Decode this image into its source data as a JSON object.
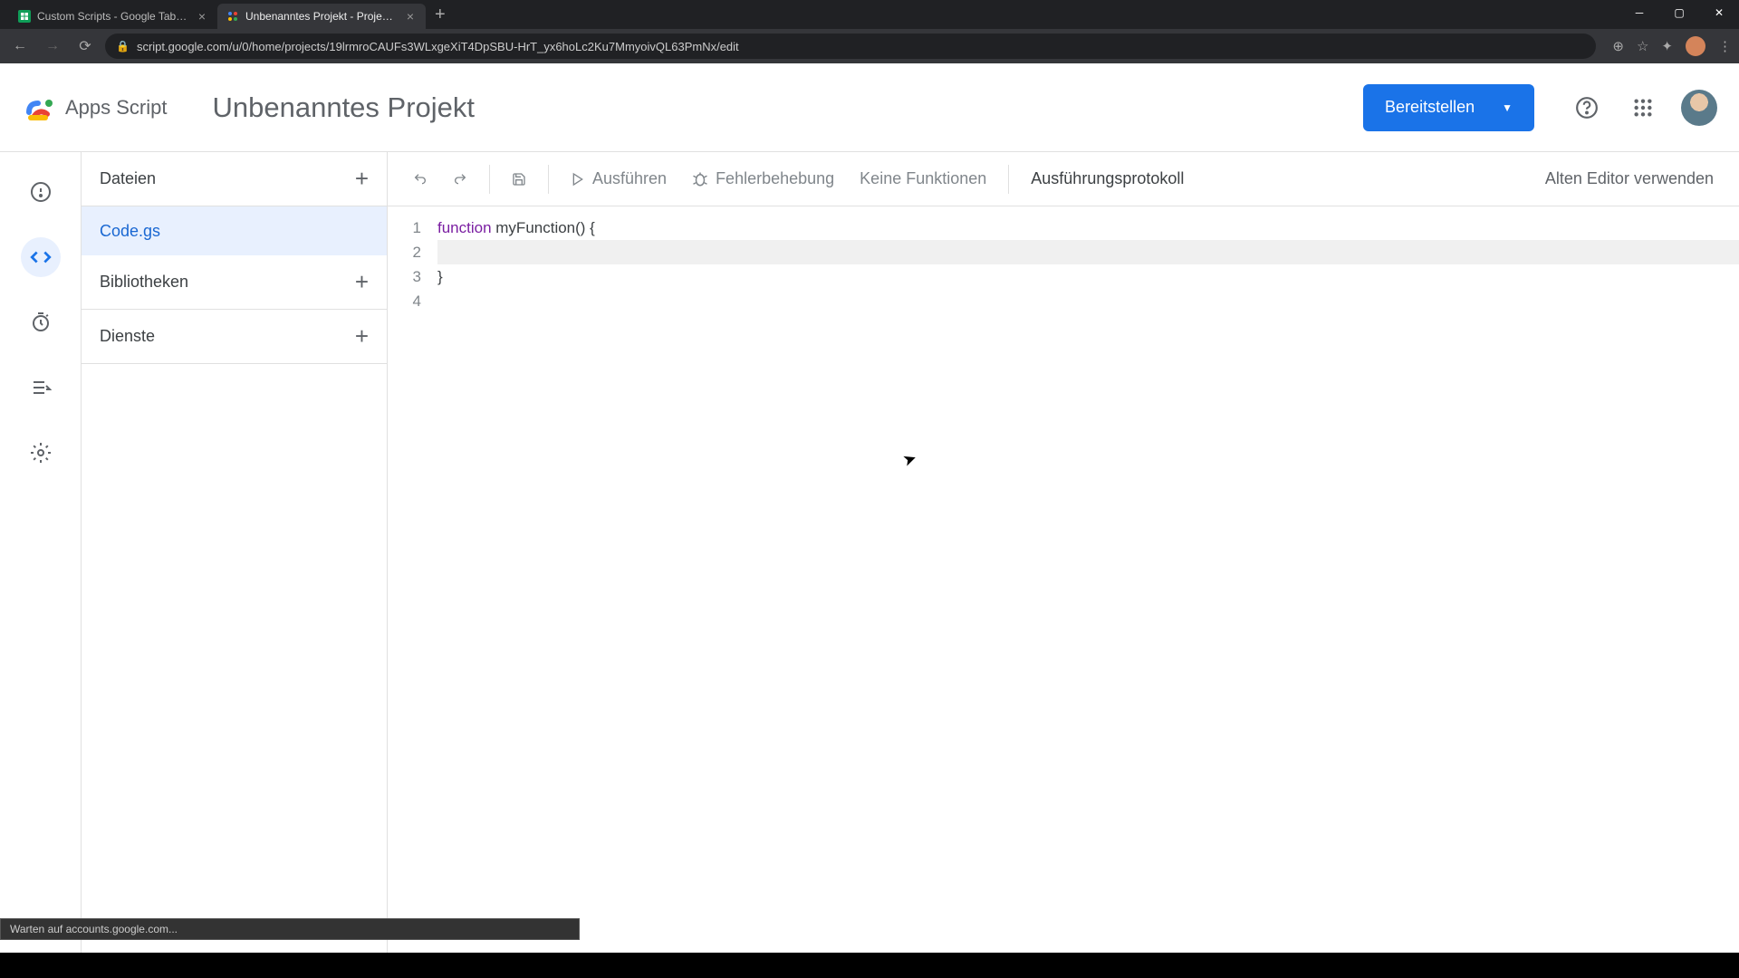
{
  "browser": {
    "tabs": [
      {
        "title": "Custom Scripts - Google Tabellen",
        "active": false
      },
      {
        "title": "Unbenanntes Projekt - Projekt-E",
        "active": true
      }
    ],
    "url": "script.google.com/u/0/home/projects/19lrmroCAUFs3WLxgeXiT4DpSBU-HrT_yx6hoLc2Ku7MmyoivQL63PmNx/edit"
  },
  "header": {
    "apps_title": "Apps Script",
    "project_title": "Unbenanntes Projekt",
    "deploy_label": "Bereitstellen"
  },
  "sidebar": {
    "files_label": "Dateien",
    "files": [
      "Code.gs"
    ],
    "libraries_label": "Bibliotheken",
    "services_label": "Dienste"
  },
  "toolbar": {
    "run_label": "Ausführen",
    "debug_label": "Fehlerbehebung",
    "func_selector": "Keine Funktionen",
    "exec_log_label": "Ausführungsprotokoll",
    "legacy_label": "Alten Editor verwenden"
  },
  "code": {
    "lines": [
      "1",
      "2",
      "3",
      "4"
    ],
    "l1_kw": "function",
    "l1_rest": " myFunction() {",
    "l2": "  ",
    "l3": "}",
    "l4": ""
  },
  "status": "Warten auf accounts.google.com..."
}
